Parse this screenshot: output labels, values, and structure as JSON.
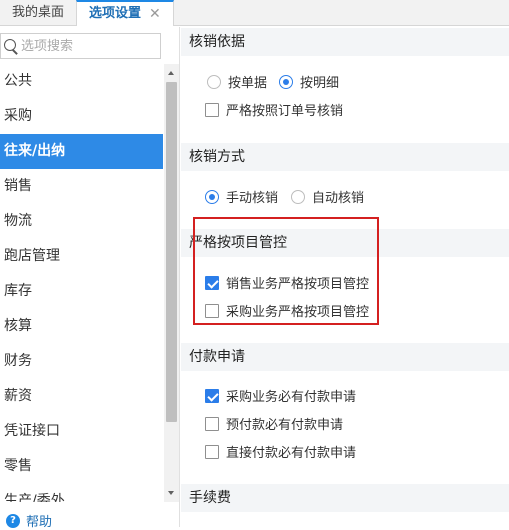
{
  "tabs": [
    {
      "label": "我的桌面",
      "active": false
    },
    {
      "label": "选项设置",
      "active": true,
      "close": "✕"
    }
  ],
  "sidebar": {
    "search_placeholder": "选项搜索",
    "items": [
      "公共",
      "采购",
      "往来/出纳",
      "销售",
      "物流",
      "跑店管理",
      "库存",
      "核算",
      "财务",
      "薪资",
      "凭证接口",
      "零售",
      "生产/委外"
    ],
    "active_index": 2,
    "help_label": "帮助"
  },
  "sections": {
    "s1": {
      "title": "核销依据",
      "radios": [
        {
          "label": "按单据",
          "checked": false
        },
        {
          "label": "按明细",
          "checked": true
        }
      ],
      "checkbox": {
        "label": "严格按照订单号核销",
        "checked": false
      }
    },
    "s2": {
      "title": "核销方式",
      "radios": [
        {
          "label": "手动核销",
          "checked": true
        },
        {
          "label": "自动核销",
          "checked": false
        }
      ]
    },
    "s3": {
      "title": "严格按项目管控",
      "checkboxes": [
        {
          "label": "销售业务严格按项目管控",
          "checked": true
        },
        {
          "label": "采购业务严格按项目管控",
          "checked": false
        }
      ]
    },
    "s4": {
      "title": "付款申请",
      "checkboxes": [
        {
          "label": "采购业务必有付款申请",
          "checked": true
        },
        {
          "label": "预付款必有付款申请",
          "checked": false
        },
        {
          "label": "直接付款必有付款申请",
          "checked": false
        }
      ]
    },
    "s5": {
      "title": "手续费"
    }
  },
  "colors": {
    "accent": "#2e8ae6",
    "highlight": "#d42020"
  }
}
